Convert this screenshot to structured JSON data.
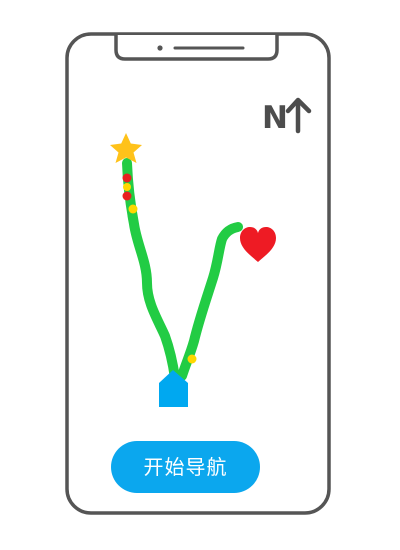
{
  "compass": {
    "north_label": "N",
    "icon": "north-arrow-icon"
  },
  "route": {
    "start_marker": "home-pentagon-icon",
    "waypoint_marker": "star-icon",
    "destination_marker": "heart-icon",
    "dot_count": 5
  },
  "actions": {
    "start_navigation_label": "开始导航"
  },
  "colors": {
    "phone_frame": "#555555",
    "route_line": "#22cc44",
    "button_bg": "#0ba7ee",
    "start_marker": "#00a8f0",
    "star": "#ffc21a",
    "heart": "#ee1b24",
    "dot_yellow": "#ffd700",
    "dot_red": "#e82020"
  }
}
